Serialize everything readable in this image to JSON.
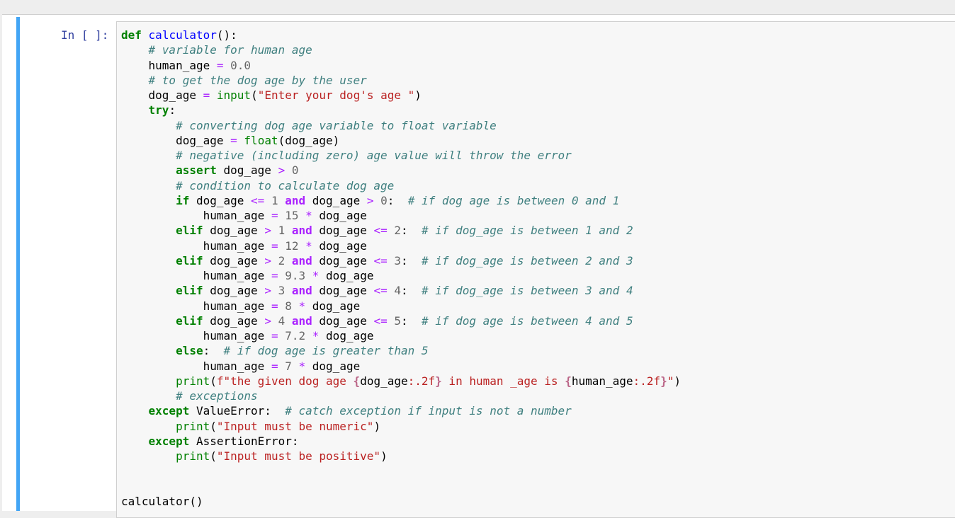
{
  "cell": {
    "prompt": "In [ ]:",
    "lines": [
      "def calculator():",
      "    # variable for human age",
      "    human_age = 0.0",
      "    # to get the dog age by the user",
      "    dog_age = input(\"Enter your dog's age \")",
      "    try:",
      "        # converting dog age variable to float variable",
      "        dog_age = float(dog_age)",
      "        # negative (including zero) age value will throw the error",
      "        assert dog_age > 0",
      "        # condition to calculate dog age",
      "        if dog_age <= 1 and dog_age > 0:  # if dog age is between 0 and 1",
      "            human_age = 15 * dog_age",
      "        elif dog_age > 1 and dog_age <= 2:  # if dog_age is between 1 and 2",
      "            human_age = 12 * dog_age",
      "        elif dog_age > 2 and dog_age <= 3:  # if dog_age is between 2 and 3",
      "            human_age = 9.3 * dog_age",
      "        elif dog_age > 3 and dog_age <= 4:  # if dog_age is between 3 and 4",
      "            human_age = 8 * dog_age",
      "        elif dog_age > 4 and dog_age <= 5:  # if dog age is between 4 and 5",
      "            human_age = 7.2 * dog_age",
      "        else:  # if dog age is greater than 5",
      "            human_age = 7 * dog_age",
      "        print(f\"the given dog age {dog_age:.2f} in human _age is {human_age:.2f}\")",
      "        # exceptions",
      "    except ValueError:  # catch exception if input is not a number",
      "        print(\"Input must be numeric\")",
      "    except AssertionError:",
      "        print(\"Input must be positive\")",
      "",
      "",
      "calculator()"
    ]
  },
  "colors": {
    "cell_border": "#42a5f5",
    "prompt": "#303f9f",
    "keyword": "#008000",
    "function_name": "#0000ff",
    "comment": "#408080",
    "operator": "#aa22ff",
    "string": "#ba2121",
    "number": "#666666"
  }
}
